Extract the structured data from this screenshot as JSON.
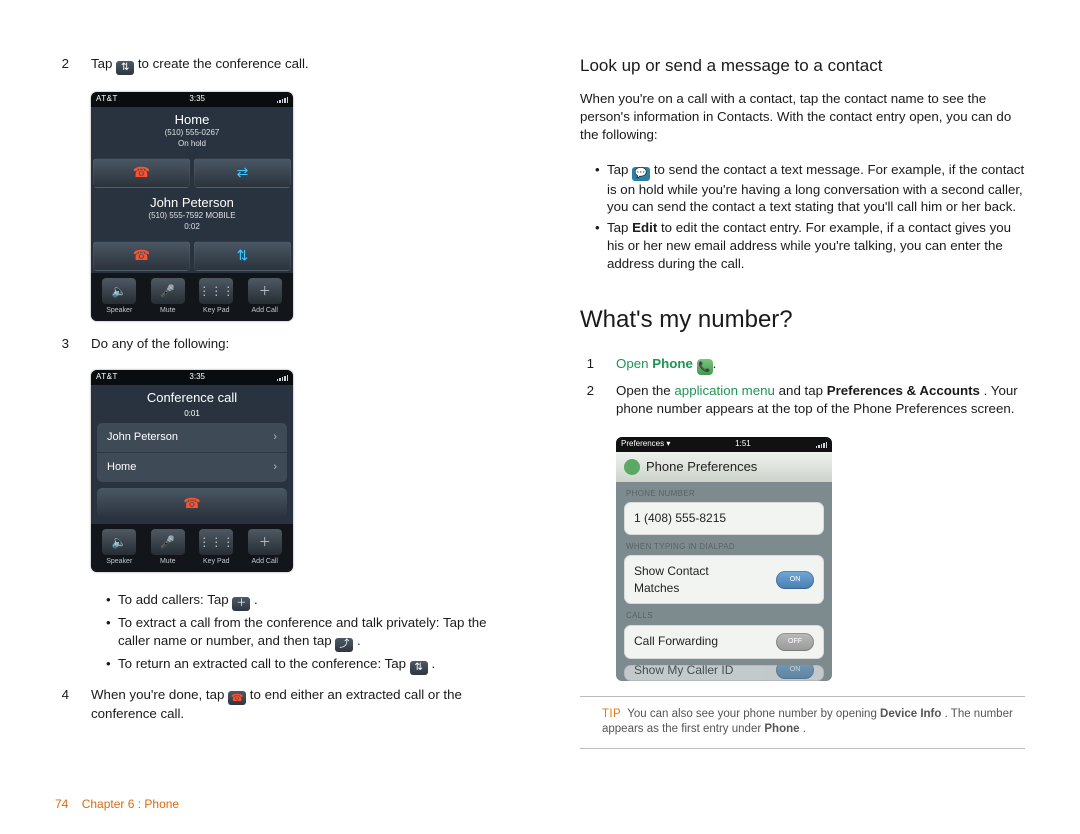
{
  "left": {
    "step2": {
      "num": "2",
      "pre": "Tap ",
      "post": " to create the conference call."
    },
    "phone1": {
      "carrier": "AT&T",
      "time": "3:35",
      "name1": "Home",
      "sub1a": "(510) 555-0267",
      "sub1b": "On hold",
      "name2": "John Peterson",
      "sub2a": "(510) 555-7592 MOBILE",
      "sub2b": "0:02",
      "btn1": "Speaker",
      "btn2": "Mute",
      "btn3": "Key Pad",
      "btn4": "Add Call"
    },
    "step3": {
      "num": "3",
      "text": "Do any of the following:"
    },
    "phone2": {
      "carrier": "AT&T",
      "time": "3:35",
      "title": "Conference call",
      "dur": "0:01",
      "row1": "John Peterson",
      "row2": "Home",
      "btn1": "Speaker",
      "btn2": "Mute",
      "btn3": "Key Pad",
      "btn4": "Add Call"
    },
    "bullets": {
      "b1_pre": "To add callers: Tap ",
      "b1_post": ".",
      "b2_pre": "To extract a call from the conference and talk privately: Tap the caller name or number, and then tap ",
      "b2_post": ".",
      "b3_pre": "To return an extracted call to the conference: Tap ",
      "b3_post": "."
    },
    "step4": {
      "num": "4",
      "pre": "When you're done, tap ",
      "post": " to end either an extracted call or the conference call."
    }
  },
  "right": {
    "h3": "Look up or send a message to a contact",
    "intro": "When you're on a call with a contact, tap the contact name to see the person's information in Contacts. With the contact entry open, you can do the following:",
    "b1_pre": "Tap ",
    "b1_post": " to send the contact a text message. For example, if the contact is on hold while you're having a long conversation with a second caller, you can send the contact a text stating that you'll call him or her back.",
    "b2_pre": "Tap ",
    "b2_bold": "Edit",
    "b2_post": " to edit the contact entry. For example, if a contact gives you his or her new email address while you're talking, you can enter the address during the call.",
    "h2": "What's my number?",
    "s1": {
      "num": "1",
      "link": "Open ",
      "bold": "Phone",
      "post": "."
    },
    "s2": {
      "num": "2",
      "pre": "Open the ",
      "link": "application menu",
      "mid": " and tap ",
      "bold": "Preferences & Accounts",
      "post": ". Your phone number appears at the top of the Phone Preferences screen."
    },
    "prefs": {
      "menu": "Preferences",
      "time": "1:51",
      "title": "Phone Preferences",
      "sec1": "PHONE NUMBER",
      "num": "1 (408) 555-8215",
      "sec2": "WHEN TYPING IN DIALPAD",
      "row2": "Show Contact Matches",
      "row2state": "ON",
      "sec3": "CALLS",
      "row3": "Call Forwarding",
      "row3state": "OFF",
      "row4": "Show My Caller ID",
      "row4state": "ON"
    },
    "tip": {
      "label": "TIP",
      "pre": "You can also see your phone number by opening ",
      "bold1": "Device Info",
      "mid": ". The number appears as the first entry under ",
      "bold2": "Phone",
      "post": "."
    }
  },
  "footer": {
    "pagenum": "74",
    "label": "Chapter 6 : Phone"
  }
}
